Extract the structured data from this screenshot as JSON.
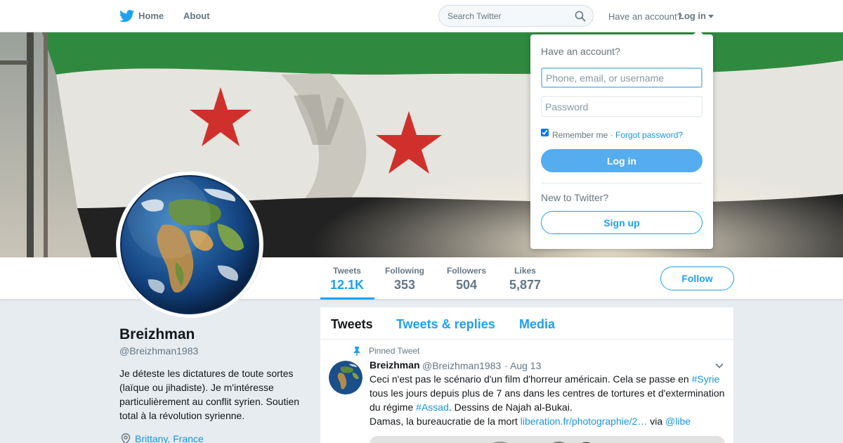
{
  "nav": {
    "home_label": "Home",
    "about_label": "About",
    "search_placeholder": "Search Twitter",
    "have_account": "Have an account?",
    "login_label": "Log in",
    "icons": {
      "logo": "twitter-bird-icon",
      "search": "search-icon",
      "caret": "caret-down-icon"
    }
  },
  "profile": {
    "name": "Breizhman",
    "handle": "@Breizhman1983",
    "bio": "Je déteste les dictatures de toute sortes (laïque ou jihadiste). Je m'intéresse particulièrement au conflit syrien. Soutien total à la révolution syrienne.",
    "location": "Brittany, France"
  },
  "stats": [
    {
      "label": "Tweets",
      "value": "12.1K"
    },
    {
      "label": "Following",
      "value": "353"
    },
    {
      "label": "Followers",
      "value": "504"
    },
    {
      "label": "Likes",
      "value": "5,877"
    }
  ],
  "follow_label": "Follow",
  "timeline": {
    "tabs": [
      "Tweets",
      "Tweets & replies",
      "Media"
    ],
    "pinned_label": "Pinned Tweet",
    "tweet": {
      "name": "Breizhman",
      "handle": "@Breizhman1983",
      "separator": "·",
      "date": "Aug 13",
      "text_1": "Ceci n'est pas le scénario d'un film d'horreur américain. Cela se passe en ",
      "hashtag_1": "#Syrie",
      "text_2": " tous les jours depuis plus de 7 ans dans les centres de tortures et d'extermination du régime ",
      "hashtag_2": "#Assad",
      "text_3": ". Dessins de Najah al-Bukai.",
      "text_4": "Damas, la bureaucratie de la mort ",
      "link": "liberation.fr/photographie/2…",
      "via": " via ",
      "mention": "@libe"
    }
  },
  "login_dropdown": {
    "title": "Have an account?",
    "username_placeholder": "Phone, email, or username",
    "password_placeholder": "Password",
    "remember_label": "Remember me ·",
    "forgot_label": "Forgot password?",
    "login_button": "Log in",
    "new_label": "New to Twitter?",
    "signup_button": "Sign up"
  },
  "colors": {
    "accent": "#1da1f2",
    "link": "#1b95e0",
    "login_button": "#55acee",
    "flag_green": "#2e8b3e",
    "flag_white": "#e8e6e0",
    "flag_black": "#1e1e1e",
    "flag_star": "#d22a2a"
  }
}
